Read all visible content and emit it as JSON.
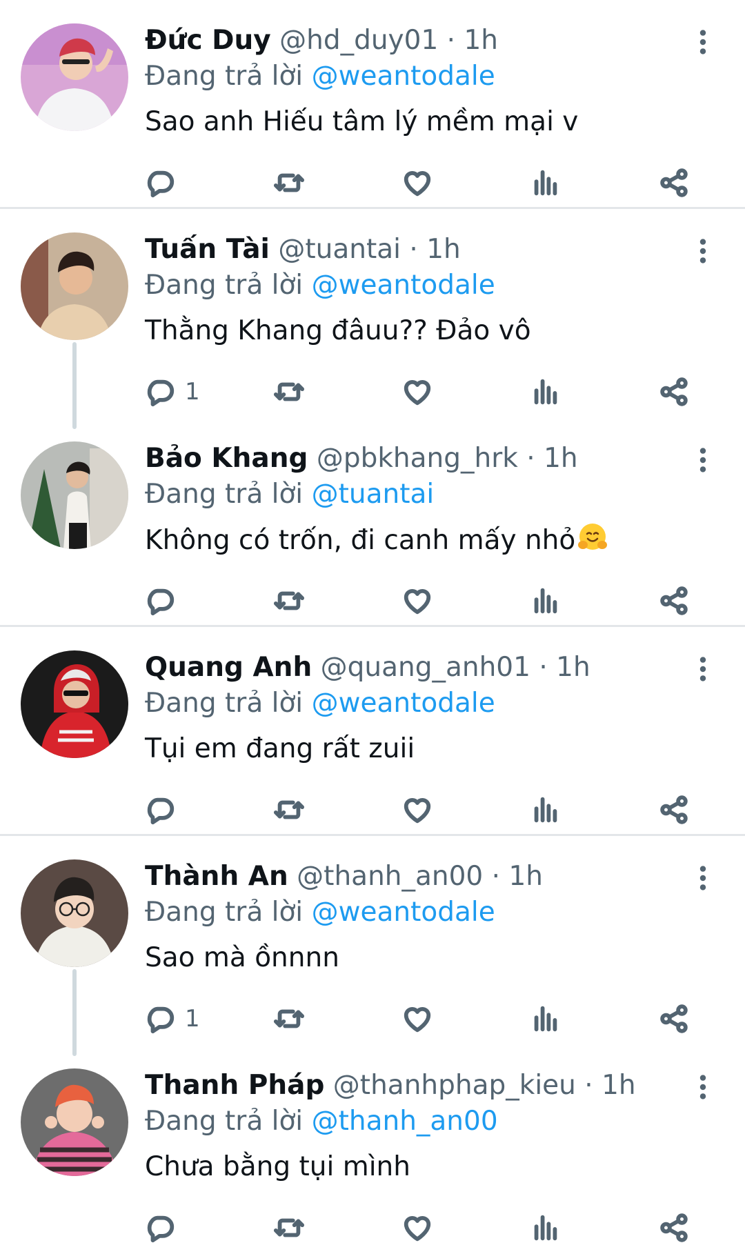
{
  "colors": {
    "text_primary": "#0f1419",
    "text_secondary": "#536471",
    "accent": "#1d9bf0",
    "divider": "#e3e6e9",
    "thread_line": "#cfd9de"
  },
  "icons": {
    "reply": "reply-icon",
    "retweet": "retweet-icon",
    "like": "heart-icon",
    "views": "views-icon",
    "share": "share-icon",
    "more": "more-options-icon"
  },
  "tweets": [
    {
      "name": "Đức Duy",
      "handle": "@hd_duy01",
      "separator": "·",
      "time": "1h",
      "replying_prefix": "Đang trả lời",
      "replying_to": "@weantodale",
      "text": "Sao anh Hiếu tâm lý mềm mại v",
      "reply_count": ""
    },
    {
      "name": "Tuấn Tài",
      "handle": "@tuantai",
      "separator": "·",
      "time": "1h",
      "replying_prefix": "Đang trả lời",
      "replying_to": "@weantodale",
      "text": "Thằng Khang đâuu?? Đảo vô",
      "reply_count": "1"
    },
    {
      "name": "Bảo Khang",
      "handle": "@pbkhang_hrk",
      "separator": "·",
      "time": "1h",
      "replying_prefix": "Đang trả lời",
      "replying_to": "@tuantai",
      "text": "Không có trốn, đi canh mấy nhỏ",
      "emoji": "hugging-face",
      "reply_count": ""
    },
    {
      "name": "Quang Anh",
      "handle": "@quang_anh01",
      "separator": "·",
      "time": "1h",
      "replying_prefix": "Đang trả lời",
      "replying_to": "@weantodale",
      "text": "Tụi em đang rất zuii",
      "reply_count": ""
    },
    {
      "name": "Thành An",
      "handle": "@thanh_an00",
      "separator": "·",
      "time": "1h",
      "replying_prefix": "Đang trả lời",
      "replying_to": "@weantodale",
      "text": "Sao mà ồnnnn",
      "reply_count": "1"
    },
    {
      "name": "Thanh Pháp",
      "handle": "@thanhphap_kieu",
      "separator": "·",
      "time": "1h",
      "replying_prefix": "Đang trả lời",
      "replying_to": "@thanh_an00",
      "text": "Chưa bằng tụi mình",
      "reply_count": ""
    }
  ]
}
